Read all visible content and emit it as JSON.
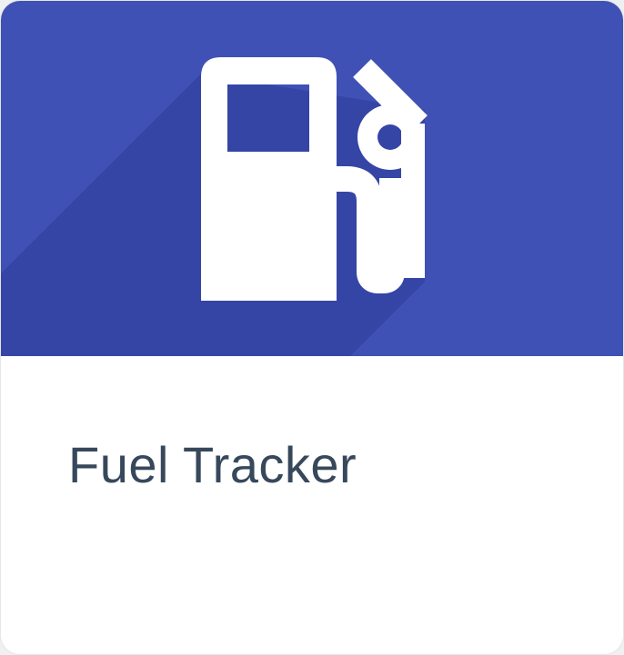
{
  "app_tile": {
    "title": "Fuel Tracker",
    "icon": "fuel-pump-icon",
    "colors": {
      "banner": "#3f51b5",
      "banner_shadow": "#3545a6",
      "icon": "#ffffff",
      "title_text": "#37485c",
      "card_background": "#ffffff"
    }
  }
}
